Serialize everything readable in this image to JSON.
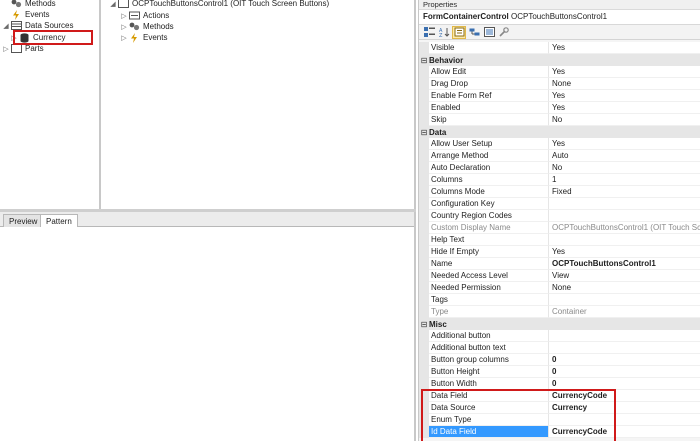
{
  "left_tree": {
    "items": [
      {
        "label": "Methods",
        "icon": "methods-icon",
        "expandable": false
      },
      {
        "label": "Events",
        "icon": "lightning-icon",
        "expandable": false
      },
      {
        "label": "Data Sources",
        "icon": "datasources-icon",
        "expandable": true
      },
      {
        "label": "Currency",
        "icon": "database-icon",
        "expandable": true
      },
      {
        "label": "Parts",
        "icon": "parts-icon",
        "expandable": true
      }
    ]
  },
  "mid_tree": {
    "root_label": "OCPTouchButtonsControl1 (OIT Touch Screen Buttons)",
    "children": [
      {
        "label": "Actions",
        "icon": "actions-icon"
      },
      {
        "label": "Methods",
        "icon": "methods-icon"
      },
      {
        "label": "Events",
        "icon": "lightning-icon"
      }
    ]
  },
  "bottom_tabs": [
    {
      "label": "Preview",
      "active": false
    },
    {
      "label": "Pattern",
      "active": true
    }
  ],
  "properties": {
    "title": "Properties",
    "object_type": "FormContainerControl",
    "object_name": "OCPTouchButtonsControl1",
    "rows": [
      {
        "kind": "prop",
        "name": "Visible",
        "value": "Yes"
      },
      {
        "kind": "cat",
        "name": "Behavior"
      },
      {
        "kind": "prop",
        "name": "Allow Edit",
        "value": "Yes"
      },
      {
        "kind": "prop",
        "name": "Drag Drop",
        "value": "None"
      },
      {
        "kind": "prop",
        "name": "Enable Form Ref",
        "value": "Yes"
      },
      {
        "kind": "prop",
        "name": "Enabled",
        "value": "Yes"
      },
      {
        "kind": "prop",
        "name": "Skip",
        "value": "No"
      },
      {
        "kind": "cat",
        "name": "Data"
      },
      {
        "kind": "prop",
        "name": "Allow User Setup",
        "value": "Yes"
      },
      {
        "kind": "prop",
        "name": "Arrange Method",
        "value": "Auto"
      },
      {
        "kind": "prop",
        "name": "Auto Declaration",
        "value": "No"
      },
      {
        "kind": "prop",
        "name": "Columns",
        "value": "1"
      },
      {
        "kind": "prop",
        "name": "Columns Mode",
        "value": "Fixed"
      },
      {
        "kind": "prop",
        "name": "Configuration Key",
        "value": ""
      },
      {
        "kind": "prop",
        "name": "Country Region Codes",
        "value": ""
      },
      {
        "kind": "prop",
        "name": "Custom Display Name",
        "value": "OCPTouchButtonsControl1 (OIT Touch Sc",
        "disabled": true
      },
      {
        "kind": "prop",
        "name": "Help Text",
        "value": ""
      },
      {
        "kind": "prop",
        "name": "Hide If Empty",
        "value": "Yes"
      },
      {
        "kind": "prop",
        "name": "Name",
        "value": "OCPTouchButtonsControl1",
        "bold": true
      },
      {
        "kind": "prop",
        "name": "Needed Access Level",
        "value": "View"
      },
      {
        "kind": "prop",
        "name": "Needed Permission",
        "value": "None"
      },
      {
        "kind": "prop",
        "name": "Tags",
        "value": ""
      },
      {
        "kind": "prop",
        "name": "Type",
        "value": "Container",
        "disabled": true
      },
      {
        "kind": "cat",
        "name": "Misc"
      },
      {
        "kind": "prop",
        "name": "Additional button",
        "value": ""
      },
      {
        "kind": "prop",
        "name": "Additional button text",
        "value": ""
      },
      {
        "kind": "prop",
        "name": "Button group columns",
        "value": "0",
        "bold": true
      },
      {
        "kind": "prop",
        "name": "Button Height",
        "value": "0",
        "bold": true
      },
      {
        "kind": "prop",
        "name": "Button Width",
        "value": "0",
        "bold": true
      },
      {
        "kind": "prop",
        "name": "Data Field",
        "value": "CurrencyCode",
        "bold": true
      },
      {
        "kind": "prop",
        "name": "Data Source",
        "value": "Currency",
        "bold": true
      },
      {
        "kind": "prop",
        "name": "Enum Type",
        "value": ""
      },
      {
        "kind": "prop",
        "name": "Id Data Field",
        "value": "CurrencyCode",
        "bold": true,
        "selected": true
      }
    ]
  },
  "colors": {
    "highlight_box": "#d01a1a",
    "selection": "#3399ff",
    "category_band": "#e6e6e6"
  }
}
